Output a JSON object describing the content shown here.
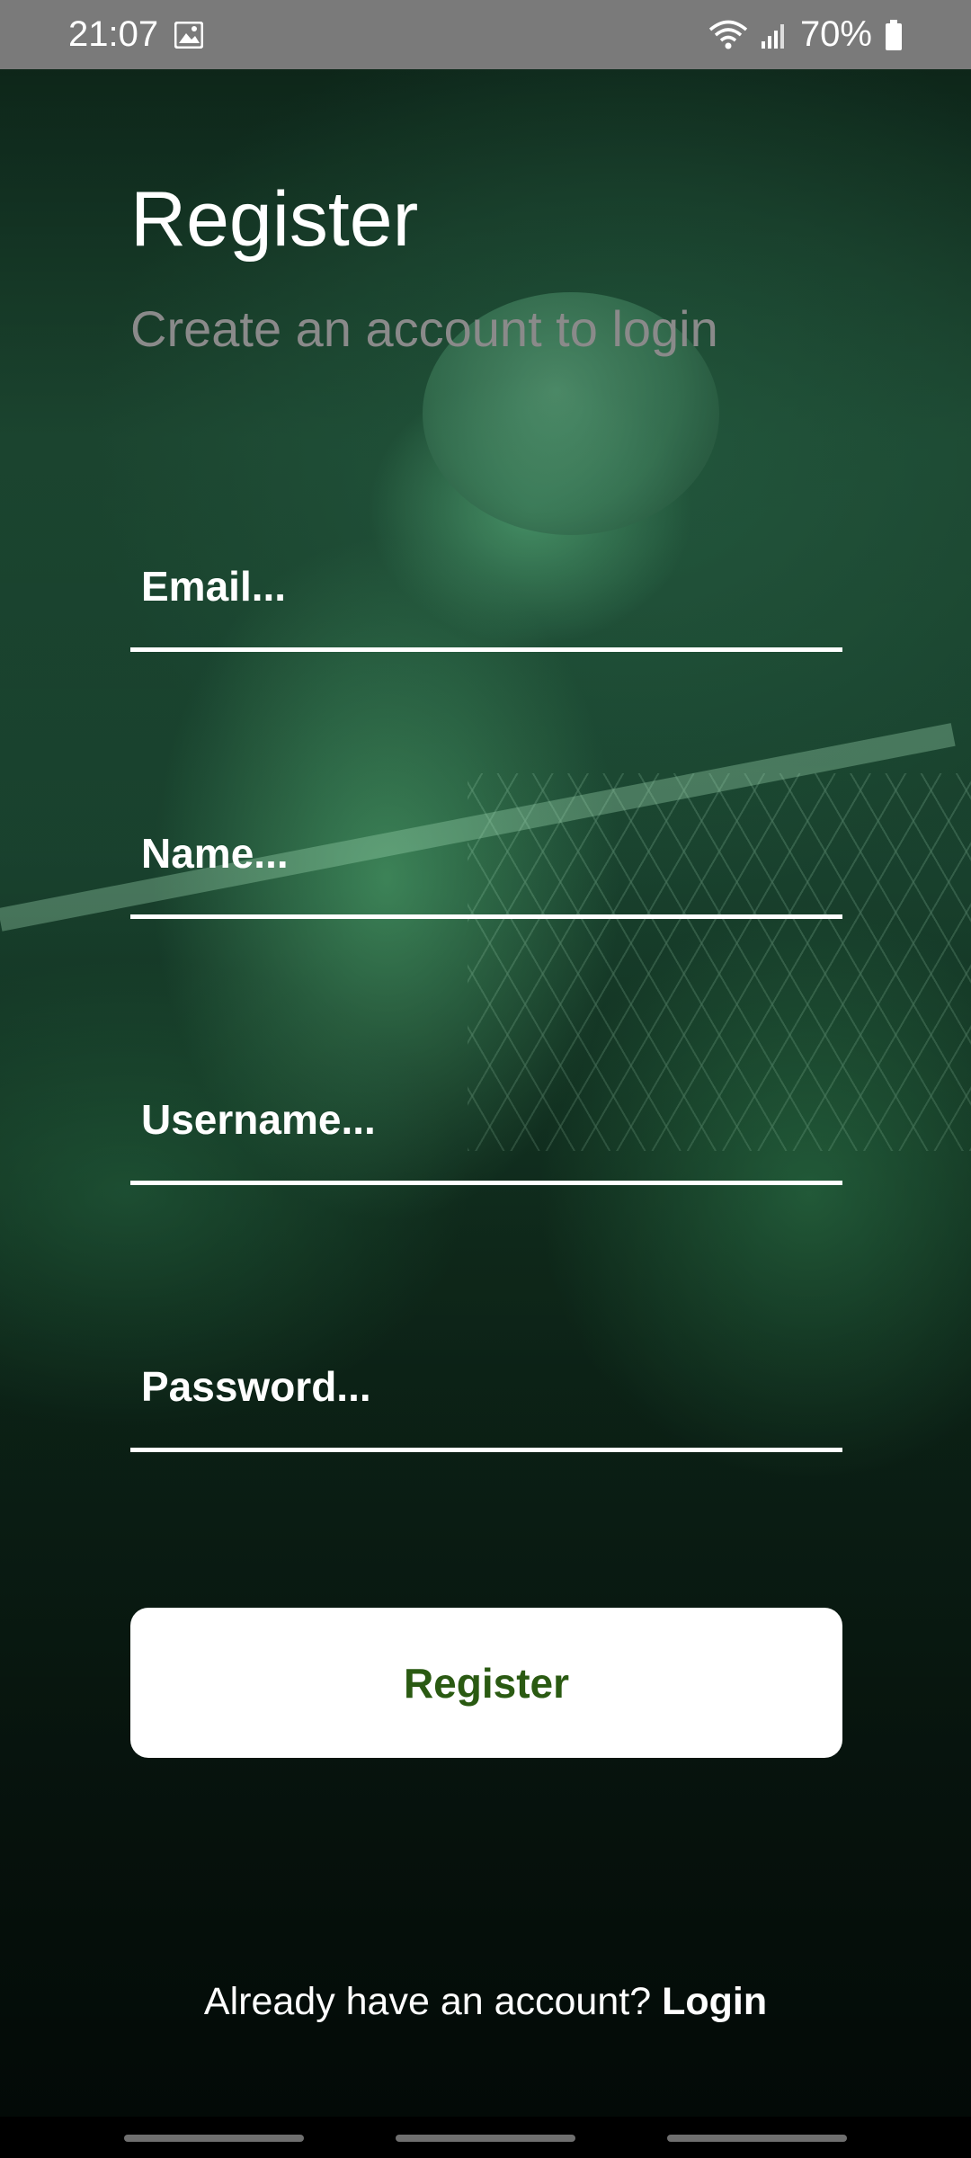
{
  "status_bar": {
    "time": "21:07",
    "battery": "70%",
    "icons": [
      "gallery-icon",
      "wifi-icon",
      "signal-icon",
      "battery-icon"
    ]
  },
  "header": {
    "title": "Register",
    "subtitle": "Create an account to login"
  },
  "form": {
    "email_placeholder": "Email...",
    "name_placeholder": "Name...",
    "username_placeholder": "Username...",
    "password_placeholder": "Password...",
    "submit_label": "Register"
  },
  "footer": {
    "question": "Already have an account?",
    "login_label": "Login"
  },
  "colors": {
    "accent_text": "#2a5a12",
    "background_tint": "#1d4a33",
    "subtitle": "#8a8a8a"
  },
  "navigation_bar": {
    "items": [
      "recent-apps",
      "home",
      "back"
    ]
  }
}
